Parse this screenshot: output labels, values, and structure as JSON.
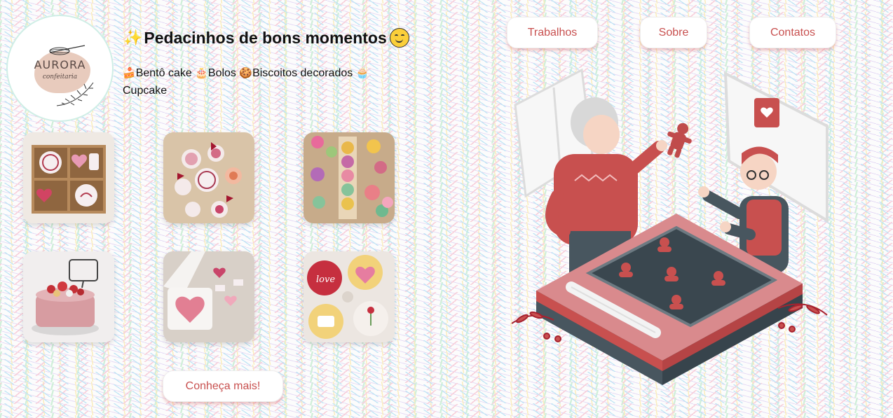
{
  "brand": {
    "logo_text": "AURORA",
    "logo_subtext": "confeitaria"
  },
  "header": {
    "title": "Pedacinhos de bons momentos",
    "title_lead_icon": "sparkles-icon",
    "title_trail_icon": "smiling-face-icon"
  },
  "categories": [
    {
      "icon": "cake-slice-icon",
      "label": "Bentô cake"
    },
    {
      "icon": "chocolate-cake-icon",
      "label": "Bolos"
    },
    {
      "icon": "cookie-icon",
      "label": "Biscoitos decorados"
    },
    {
      "icon": "cupcake-icon",
      "label": "Cupcake"
    }
  ],
  "nav": {
    "works": "Trabalhos",
    "about": "Sobre",
    "contacts": "Contatos"
  },
  "gallery": [
    {
      "subject": "bento-box-cookies"
    },
    {
      "subject": "round-decorated-cookies"
    },
    {
      "subject": "flower-cookies-box"
    },
    {
      "subject": "strawberry-cake"
    },
    {
      "subject": "bento-cake-with-heart-cookies"
    },
    {
      "subject": "decorated-cupcakes"
    }
  ],
  "cta": {
    "label": "Conheça mais!"
  },
  "colors": {
    "accent": "#c8504f",
    "accent_shadow": "#e3a0a0"
  }
}
